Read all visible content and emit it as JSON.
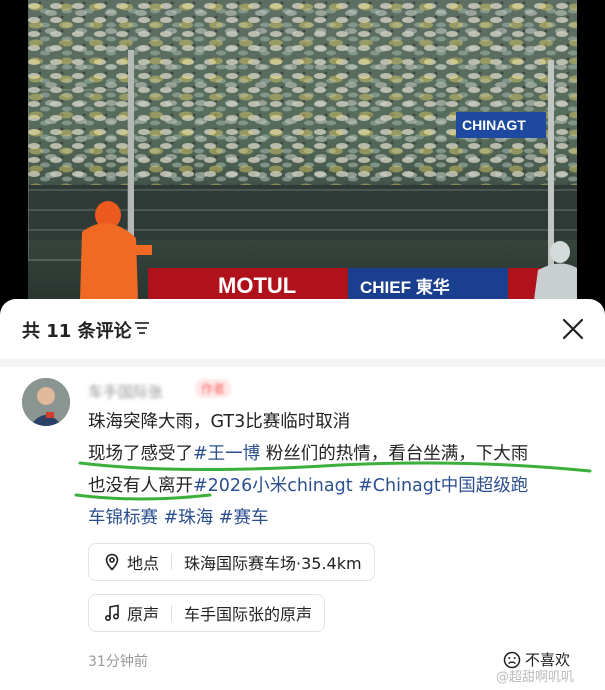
{
  "photo": {
    "banners": [
      "MOTUL",
      "CHIEF 東华"
    ],
    "sign": "CHINAGT"
  },
  "sheet": {
    "comment_count_label": "共 11 条评论",
    "comment": {
      "username": "车手国际张",
      "author_badge": "作者",
      "lines": [
        [
          {
            "t": "珠海突降大雨，GT3比赛临时取消"
          }
        ],
        [
          {
            "t": "现场了感受了"
          },
          {
            "t": "#王一博",
            "tag": true
          },
          {
            "t": " 粉丝们的热情，看台坐满，下大雨"
          }
        ],
        [
          {
            "t": "也没有人离开"
          },
          {
            "t": "#2026小米chinagt #Chinagt中国超级跑",
            "tag": true
          }
        ],
        [
          {
            "t": "车锦标赛 #珠海 #赛车",
            "tag": true
          }
        ]
      ],
      "location_label": "地点",
      "location_value": "珠海国际赛车场·35.4km",
      "sound_label": "原声",
      "sound_value": "车手国际张的原声",
      "timestamp": "31分钟前",
      "dislike_label": "不喜欢"
    }
  },
  "watermark": "@超甜啊叽叽",
  "colors": {
    "tag": "#2b4f8f",
    "highlight": "#3cae3c"
  }
}
